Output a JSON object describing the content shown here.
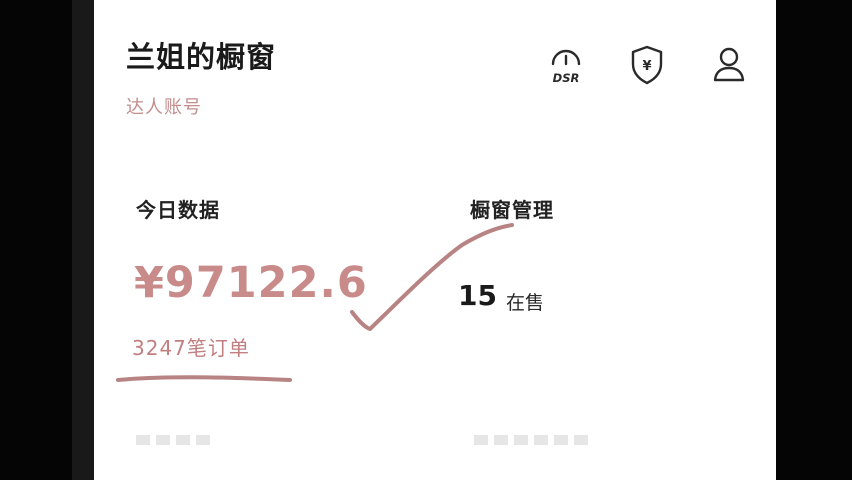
{
  "header": {
    "store_title": "兰姐的橱窗",
    "account_type": "达人账号",
    "icons": [
      "dsr-gauge-icon",
      "shield-yen-icon",
      "user-icon"
    ],
    "dsr_label": "DSR",
    "shield_symbol": "¥"
  },
  "today": {
    "label": "今日数据",
    "amount": "¥97122.6",
    "orders": "3247笔订单"
  },
  "showcase": {
    "label": "橱窗管理",
    "on_sale_count": "15",
    "on_sale_label": "在售"
  },
  "colors": {
    "accent": "#c98a8a",
    "annotation": "#b88383"
  }
}
